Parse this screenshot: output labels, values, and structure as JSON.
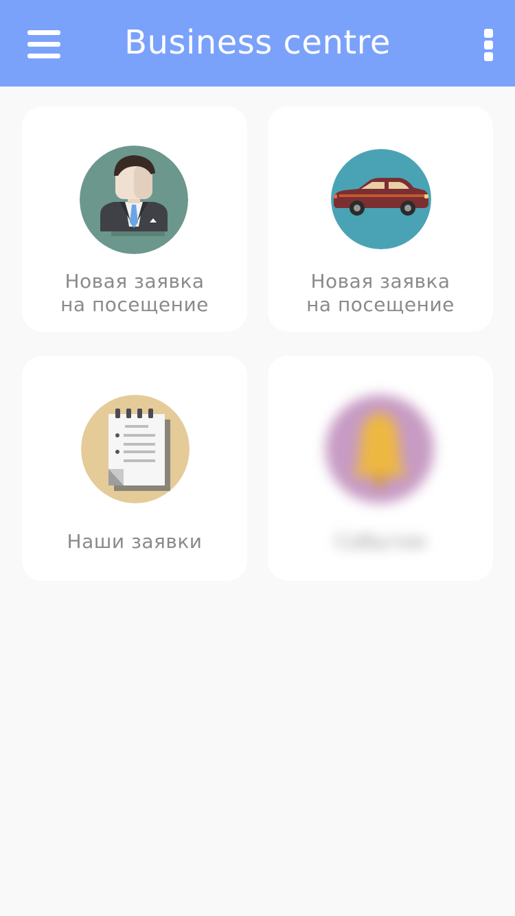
{
  "app_bar": {
    "title": "Business centre",
    "menu_icon": "hamburger-menu-icon",
    "more_icon": "more-vertical-icon",
    "color": "#7aa2fb"
  },
  "tiles": [
    {
      "icon": "visitor-person-icon",
      "label_line1": "Новая заявка",
      "label_line2": "на посещение",
      "icon_bg": "#6c978d"
    },
    {
      "icon": "car-icon",
      "label_line1": "Новая заявка",
      "label_line2": "на посещение",
      "icon_bg": "#4aa3b5"
    },
    {
      "icon": "notepad-icon",
      "label": "Наши заявки",
      "icon_bg": "#e4cb98"
    },
    {
      "icon": "bell-icon",
      "label": "События",
      "icon_bg": "#c79bc4",
      "blurred": true
    }
  ]
}
